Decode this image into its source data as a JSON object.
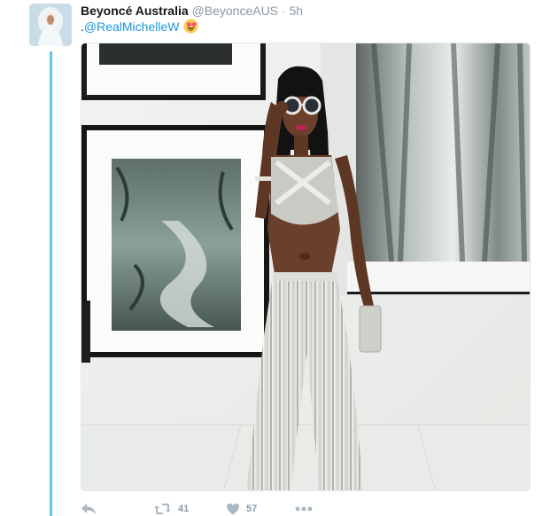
{
  "tweet": {
    "author_name": "Beyoncé Australia",
    "author_handle": "@BeyonceAUS",
    "separator": "·",
    "timestamp": "5h",
    "text_prefix": ".",
    "mention": "@RealMichelleW",
    "emoji": "heart-eyes-emoji"
  },
  "actions": {
    "reply_icon": "reply-icon",
    "retweet_icon": "retweet-icon",
    "retweet_count": "41",
    "like_icon": "heart-icon",
    "like_count": "57",
    "more_icon": "more-icon"
  },
  "colors": {
    "thread_line": "#5dc7f0",
    "mention": "#1b95e0",
    "muted": "#8899a6",
    "action_icon": "#aab8c2"
  }
}
